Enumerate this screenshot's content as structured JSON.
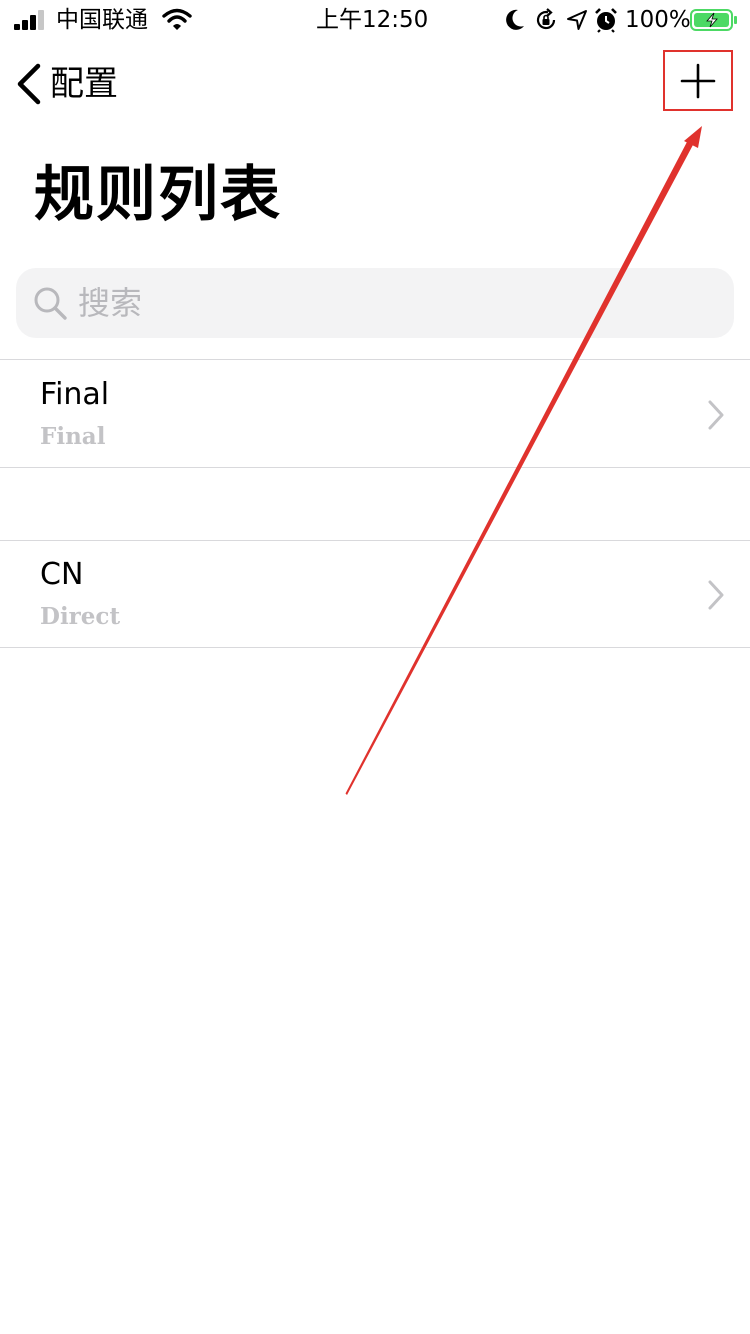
{
  "status_bar": {
    "carrier": "中国联通",
    "time": "上午12:50",
    "battery_percent": "100%",
    "icons": [
      "signal-icon",
      "wifi-icon",
      "moon-icon",
      "orientation-lock-icon",
      "location-icon",
      "alarm-icon",
      "battery-charging-icon"
    ]
  },
  "nav": {
    "back_label": "配置",
    "back_icon": "chevron-left-icon",
    "add_icon": "plus-icon",
    "highlight_color": "#e0322d"
  },
  "page": {
    "title": "规则列表"
  },
  "search": {
    "placeholder": "搜索",
    "value": "",
    "icon": "search-icon"
  },
  "rules": [
    {
      "name": "Final",
      "policy": "Final"
    },
    {
      "name": "CN",
      "policy": "Direct"
    }
  ],
  "colors": {
    "annotation": "#e0322d",
    "subtitle": "#c3c3c6",
    "search_bg": "#f3f3f4",
    "battery": "#4cd964"
  }
}
